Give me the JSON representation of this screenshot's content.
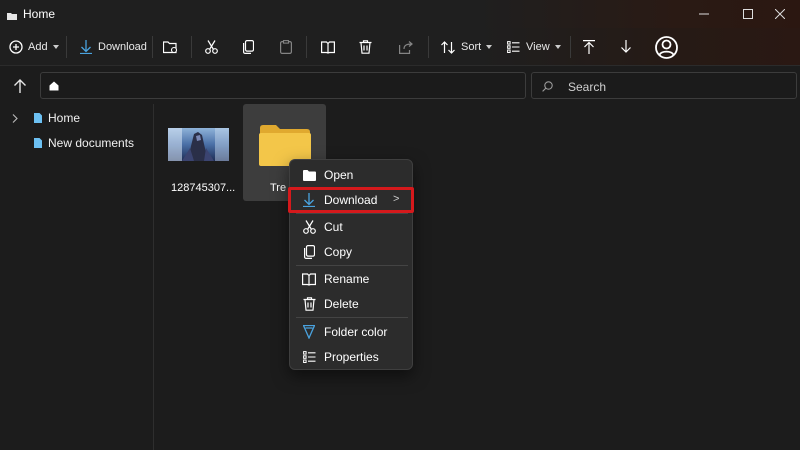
{
  "window": {
    "title": "Home"
  },
  "toolbar": {
    "add_label": "Add",
    "download_label": "Download",
    "sort_label": "Sort",
    "view_label": "View"
  },
  "search": {
    "placeholder": "Search"
  },
  "sidebar": {
    "items": [
      {
        "label": "Home"
      },
      {
        "label": "New documents"
      }
    ]
  },
  "files": [
    {
      "name": "128745307..."
    },
    {
      "name": "Tre"
    }
  ],
  "context_menu": {
    "items": [
      {
        "label": "Open",
        "icon": "folder-icon"
      },
      {
        "label": "Download",
        "icon": "download-icon",
        "submenu": ">"
      },
      {
        "label": "Cut",
        "icon": "scissors-icon"
      },
      {
        "label": "Copy",
        "icon": "copy-icon"
      },
      {
        "label": "Rename",
        "icon": "rename-icon"
      },
      {
        "label": "Delete",
        "icon": "trash-icon"
      },
      {
        "label": "Folder color",
        "icon": "folder-color-icon"
      },
      {
        "label": "Properties",
        "icon": "properties-icon"
      }
    ]
  },
  "colors": {
    "accent_blue": "#4aa3df",
    "folder_yellow": "#f3c649",
    "highlight_red": "#d5191c"
  }
}
